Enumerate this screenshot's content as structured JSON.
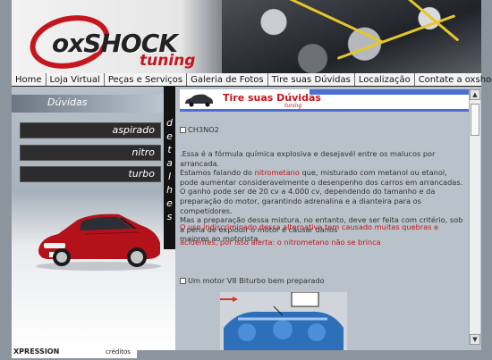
{
  "header": {
    "logo_main": "oxSHOCK",
    "logo_sub": "tuning"
  },
  "nav": [
    "Home",
    "Loja Virtual",
    "Peças e Serviços",
    "Galeria de Fotos",
    "Tire suas Dúvidas",
    "Localização",
    "Contate a oxshock"
  ],
  "sidebar": {
    "title": "Dúvidas",
    "items": [
      "aspirado",
      "nitro",
      "turbo"
    ],
    "vertical_label": "detalhes",
    "footer_logo": "XPRESSION",
    "footer_credits": "créditos"
  },
  "banner": {
    "title": "Tire suas Dúvidas",
    "subtitle": "tuning"
  },
  "article": {
    "heading": "CH3NO2",
    "p1_a": ".Essa é a fórmula química explosiva e desejavél entre os malucos por arrancada.",
    "p1_b": "Estamos falando do ",
    "p1_red": "nitrometano",
    "p1_c": " que, misturado com metanol ou etanol, pode aumentar consideravelmente o desenpenho dos carros em arrancadas. O ganho pode ser de 20 cv a 4.000 cv, dependendo do tamanho e da preparação do motor, garantindo adrenalina e a dianteira para os competidores.",
    "p1_d": "Mas a preparação dessa mistura, no entanto, deve ser feita com critério, sob a pena de explodir o motor e causar danos",
    "p1_e": "maiores ao motorista.",
    "warning": "O uso indiscriminado dessa alternativa tem causado muitas quebras e acidentes, por isso alerta: o nitrometano não se brinca",
    "caption": "Um motor V8 Biturbo bem preparado"
  },
  "colors": {
    "accent_red": "#c4161c",
    "banner_blue": "#4c6fd6"
  }
}
